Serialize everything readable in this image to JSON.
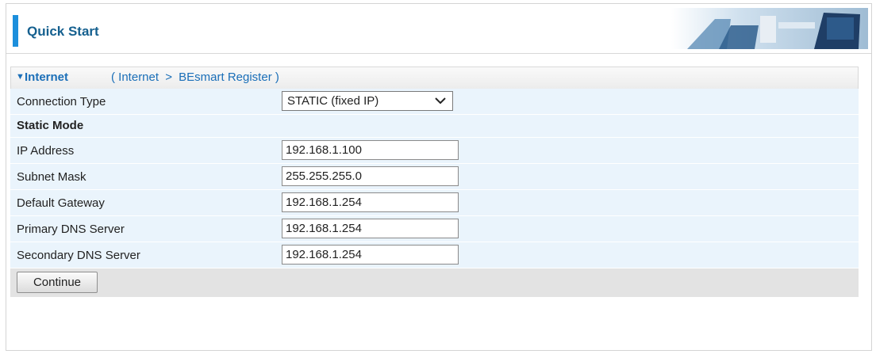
{
  "header": {
    "title": "Quick Start"
  },
  "section": {
    "title": "Internet",
    "breadcrumb_open": "(",
    "breadcrumb_parent": "Internet",
    "breadcrumb_arrow": ">",
    "breadcrumb_current": "BEsmart Register",
    "breadcrumb_close": ")"
  },
  "form": {
    "connection_type": {
      "label": "Connection Type",
      "selected": "STATIC (fixed IP)"
    },
    "static_mode_label": "Static Mode",
    "fields": [
      {
        "label": "IP Address",
        "value": "192.168.1.100"
      },
      {
        "label": "Subnet Mask",
        "value": "255.255.255.0"
      },
      {
        "label": "Default Gateway",
        "value": "192.168.1.254"
      },
      {
        "label": "Primary DNS Server",
        "value": "192.168.1.254"
      },
      {
        "label": "Secondary DNS Server",
        "value": "192.168.1.254"
      }
    ],
    "continue_label": "Continue"
  },
  "colors": {
    "accent": "#1c8fdc",
    "link": "#1b6fb8",
    "row_bg": "#eaf4fc",
    "subheader_bg": "#e3e3e3"
  }
}
